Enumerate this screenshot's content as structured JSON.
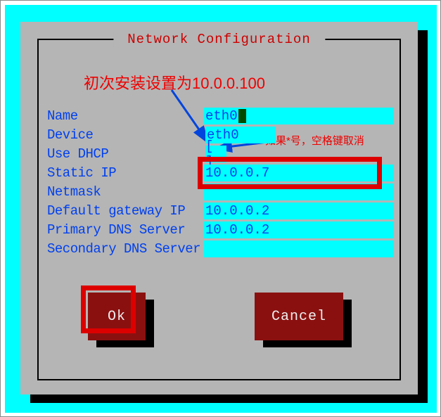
{
  "dialog": {
    "title": " Network Configuration "
  },
  "annotations": {
    "first_install": "初次安装设置为10.0.0.100",
    "asterisk_note": "如果*号，空格键取消"
  },
  "fields": {
    "name": {
      "label": "Name",
      "value": "eth0"
    },
    "device": {
      "label": "Device",
      "value": "eth0"
    },
    "use_dhcp": {
      "label": "Use DHCP",
      "value": "[ ]"
    },
    "static_ip": {
      "label": "Static IP",
      "value": "10.0.0.7"
    },
    "netmask": {
      "label": "Netmask",
      "value": ""
    },
    "gateway": {
      "label": "Default gateway IP",
      "value": "10.0.0.2"
    },
    "primary_dns": {
      "label": "Primary DNS Server",
      "value": "10.0.0.2"
    },
    "secondary_dns": {
      "label": "Secondary DNS Server",
      "value": ""
    }
  },
  "buttons": {
    "ok": "Ok",
    "cancel": "Cancel"
  }
}
